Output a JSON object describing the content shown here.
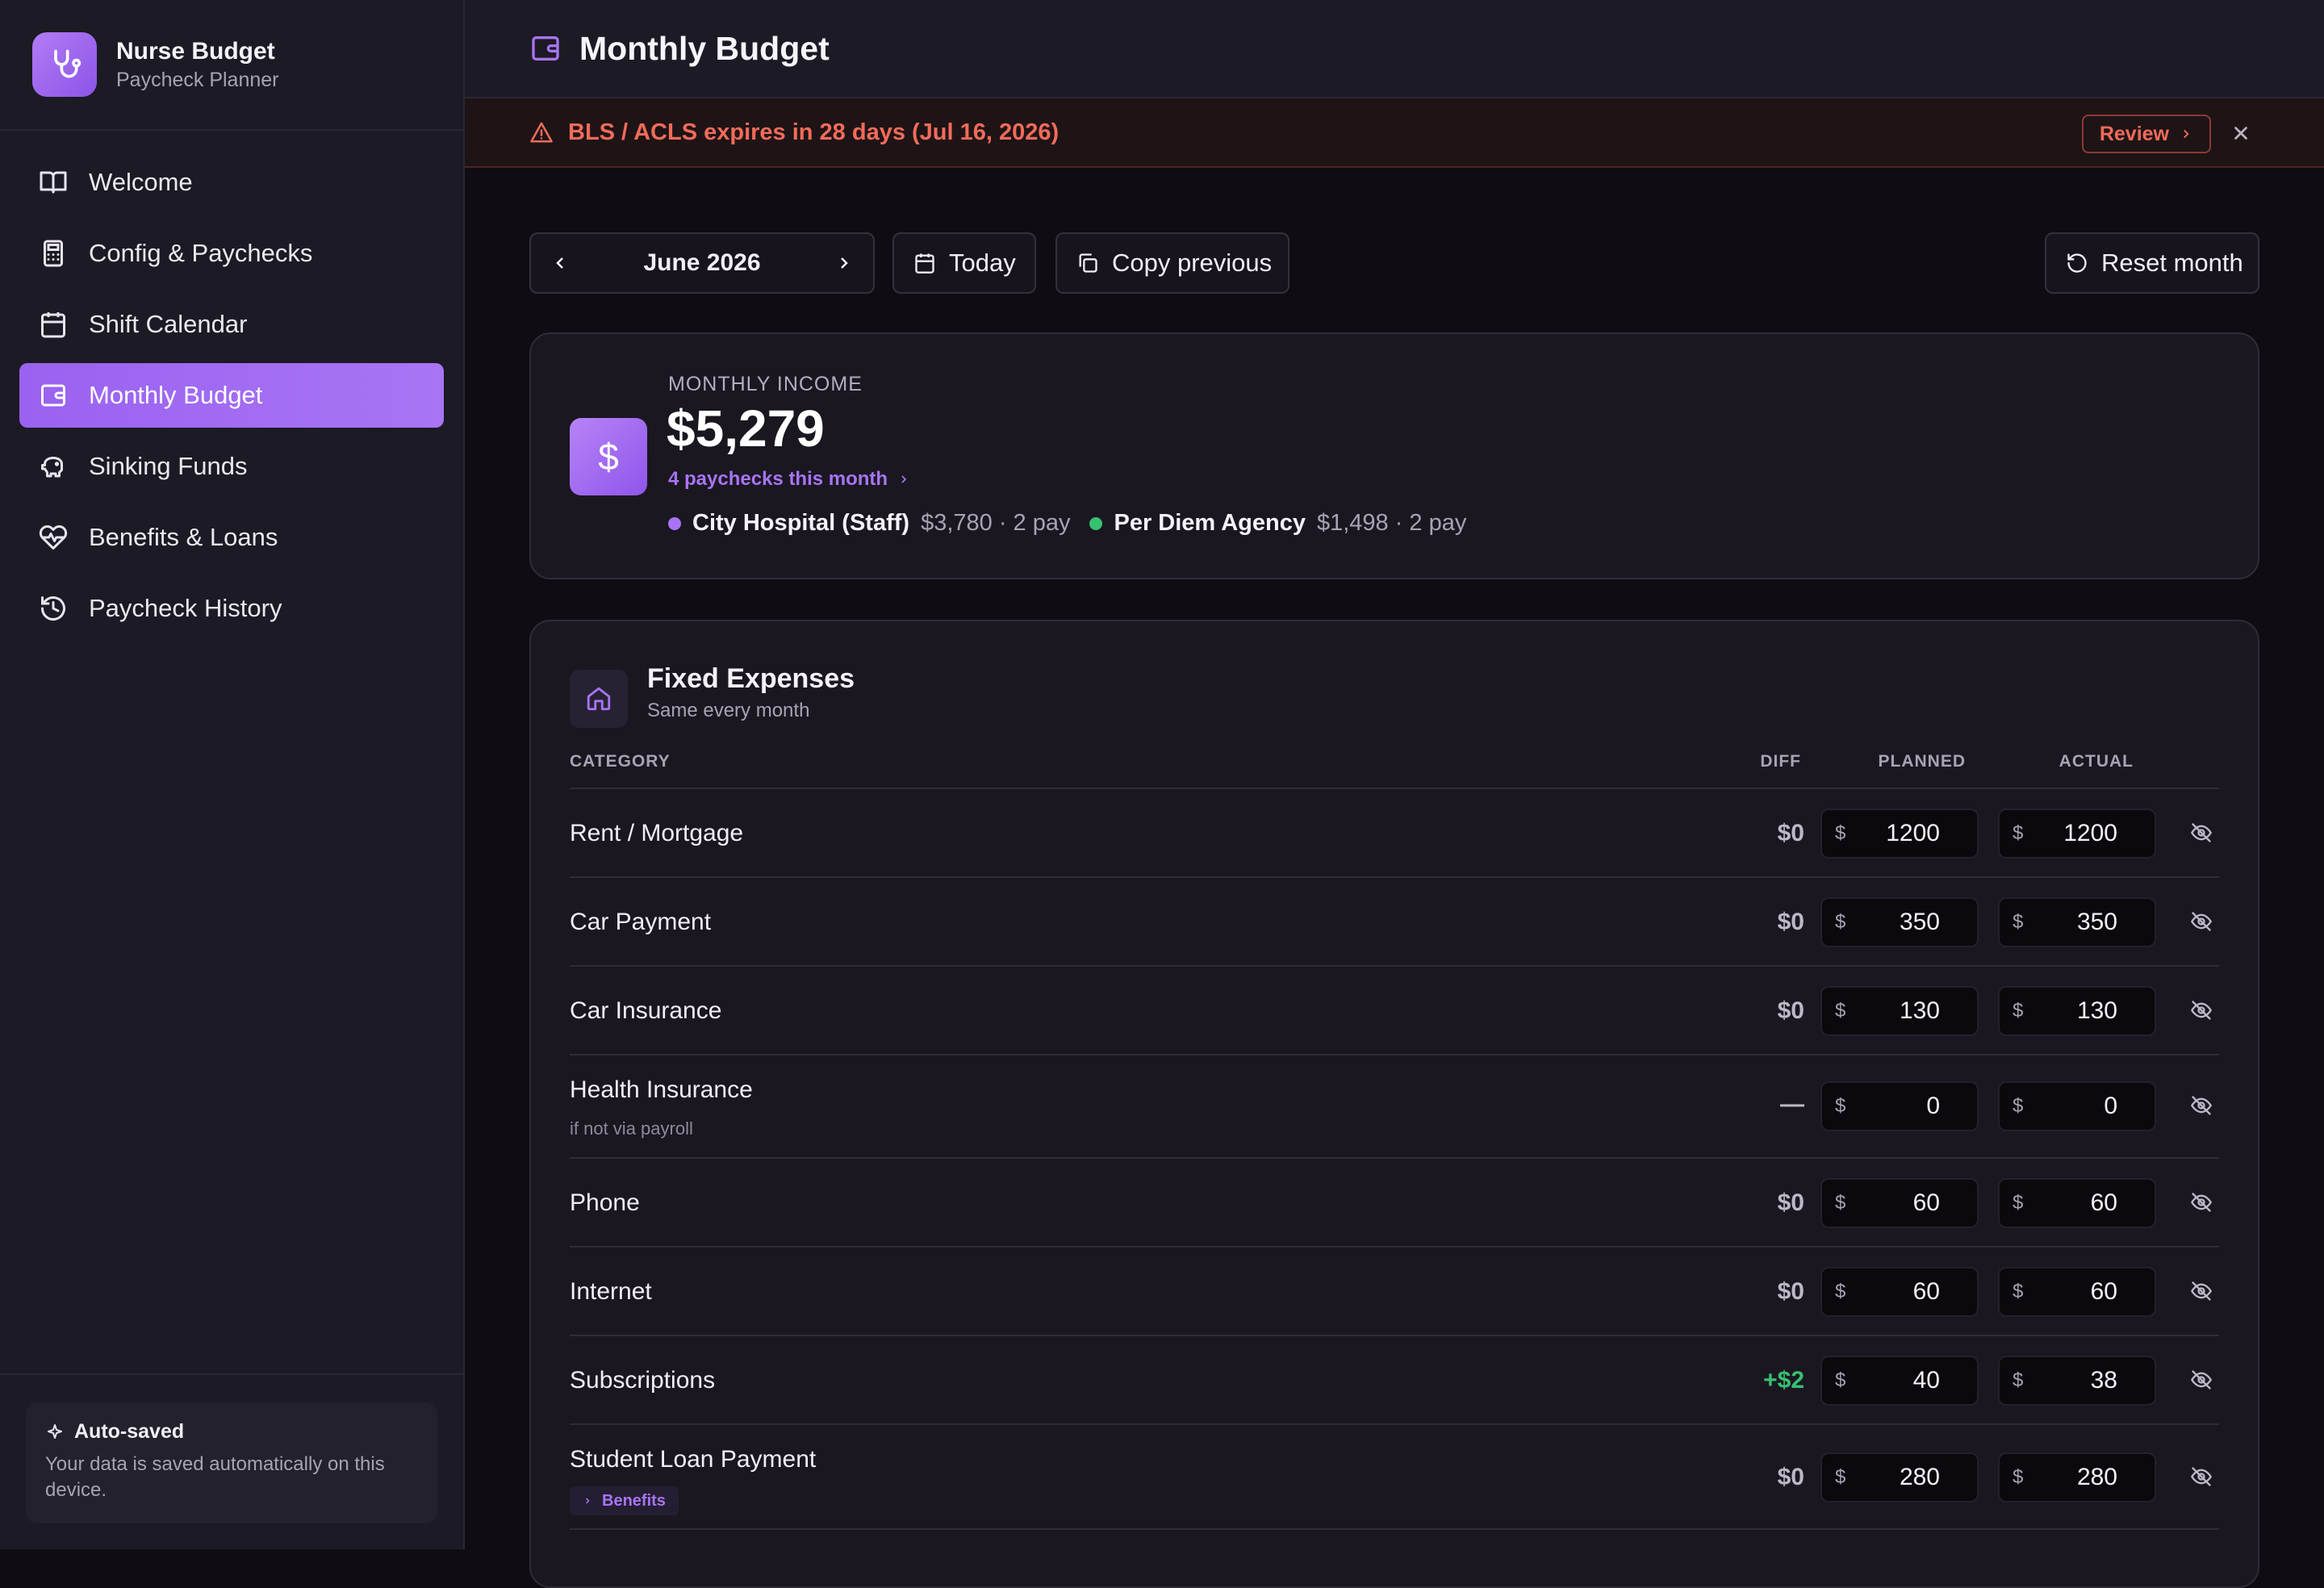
{
  "brand": {
    "title": "Nurse Budget",
    "subtitle": "Paycheck Planner"
  },
  "nav": [
    {
      "label": "Welcome",
      "icon": "book-icon"
    },
    {
      "label": "Config & Paychecks",
      "icon": "calculator-icon"
    },
    {
      "label": "Shift Calendar",
      "icon": "calendar-icon"
    },
    {
      "label": "Monthly Budget",
      "icon": "wallet-icon",
      "active": true
    },
    {
      "label": "Sinking Funds",
      "icon": "piggy-bank-icon"
    },
    {
      "label": "Benefits & Loans",
      "icon": "heart-pulse-icon"
    },
    {
      "label": "Paycheck History",
      "icon": "history-icon"
    }
  ],
  "autosave": {
    "title": "Auto-saved",
    "text": "Your data is saved automatically on this device."
  },
  "page": {
    "title": "Monthly Budget"
  },
  "alert": {
    "text": "BLS / ACLS expires in 28 days (Jul 16, 2026)",
    "review_label": "Review"
  },
  "toolbar": {
    "month": "June 2026",
    "today_label": "Today",
    "copy_label": "Copy previous",
    "reset_label": "Reset month"
  },
  "income": {
    "label": "MONTHLY INCOME",
    "value": "$5,279",
    "link": "4 paychecks this month",
    "sources": [
      {
        "name": "City Hospital (Staff)",
        "meta": "$3,780 · 2 pay",
        "color": "#a874f4"
      },
      {
        "name": "Per Diem Agency",
        "meta": "$1,498 · 2 pay",
        "color": "#37c070"
      }
    ]
  },
  "expenses": {
    "title": "Fixed Expenses",
    "subtitle": "Same every month",
    "headers": {
      "category": "CATEGORY",
      "diff": "DIFF",
      "planned": "PLANNED",
      "actual": "ACTUAL"
    },
    "currency": "$",
    "rows": [
      {
        "name": "Rent / Mortgage",
        "diff": "$0",
        "planned": "1200",
        "actual": "1200"
      },
      {
        "name": "Car Payment",
        "diff": "$0",
        "planned": "350",
        "actual": "350"
      },
      {
        "name": "Car Insurance",
        "diff": "$0",
        "planned": "130",
        "actual": "130"
      },
      {
        "name": "Health Insurance",
        "note": "if not via payroll",
        "diff": "—",
        "planned": "0",
        "actual": "0"
      },
      {
        "name": "Phone",
        "diff": "$0",
        "planned": "60",
        "actual": "60"
      },
      {
        "name": "Internet",
        "diff": "$0",
        "planned": "60",
        "actual": "60"
      },
      {
        "name": "Subscriptions",
        "diff": "+$2",
        "diff_positive": true,
        "planned": "40",
        "actual": "38"
      },
      {
        "name": "Student Loan Payment",
        "tag": "Benefits",
        "diff": "$0",
        "planned": "280",
        "actual": "280"
      }
    ]
  },
  "colors": {
    "accent": "#a874f4",
    "alert": "#f36b5a",
    "positive": "#37c070",
    "background": "#0f0c14",
    "panel": "#1c1a24"
  }
}
